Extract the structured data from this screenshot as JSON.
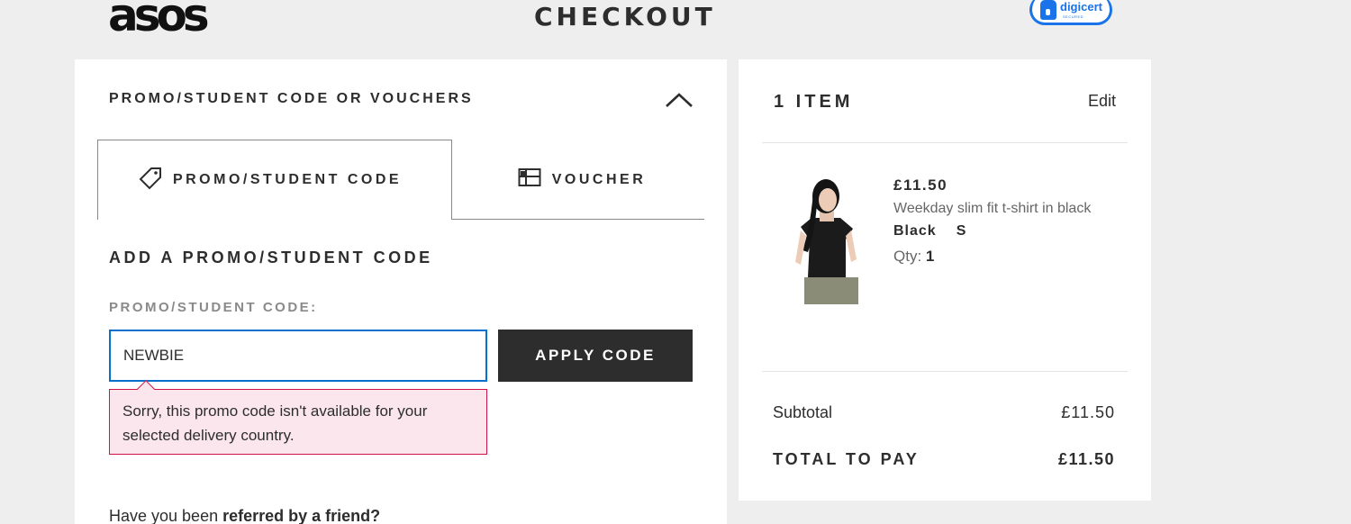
{
  "header": {
    "logo_text": "asos",
    "title": "CHECKOUT",
    "badge": {
      "brand": "digicert",
      "sub": "SECURED",
      "icon": "lock-icon"
    }
  },
  "promo_section": {
    "heading": "PROMO/STUDENT CODE OR VOUCHERS",
    "toggle_icon": "chevron-up-icon",
    "tabs": [
      {
        "label": "PROMO/STUDENT CODE",
        "icon": "tag-icon",
        "active": true
      },
      {
        "label": "VOUCHER",
        "icon": "voucher-icon",
        "active": false
      }
    ],
    "form_heading": "ADD A PROMO/STUDENT CODE",
    "field_label": "PROMO/STUDENT CODE:",
    "input_value": "NEWBIE",
    "apply_label": "APPLY CODE",
    "error_message": "Sorry, this promo code isn't available for your selected delivery country.",
    "referral_prefix": "Have you been ",
    "referral_link": "referred by a friend?",
    "colors": {
      "input_focus": "#0770cf",
      "error_border": "#d01345",
      "error_bg": "#fae6ec"
    }
  },
  "order_summary": {
    "heading": "1 ITEM",
    "edit_label": "Edit",
    "item": {
      "price": "£11.50",
      "name": "Weekday slim fit t-shirt in black",
      "color": "Black",
      "size": "S",
      "qty_label": "Qty:",
      "qty": "1"
    },
    "subtotal_label": "Subtotal",
    "subtotal_value": "£11.50",
    "total_label": "TOTAL TO PAY",
    "total_value": "£11.50"
  }
}
